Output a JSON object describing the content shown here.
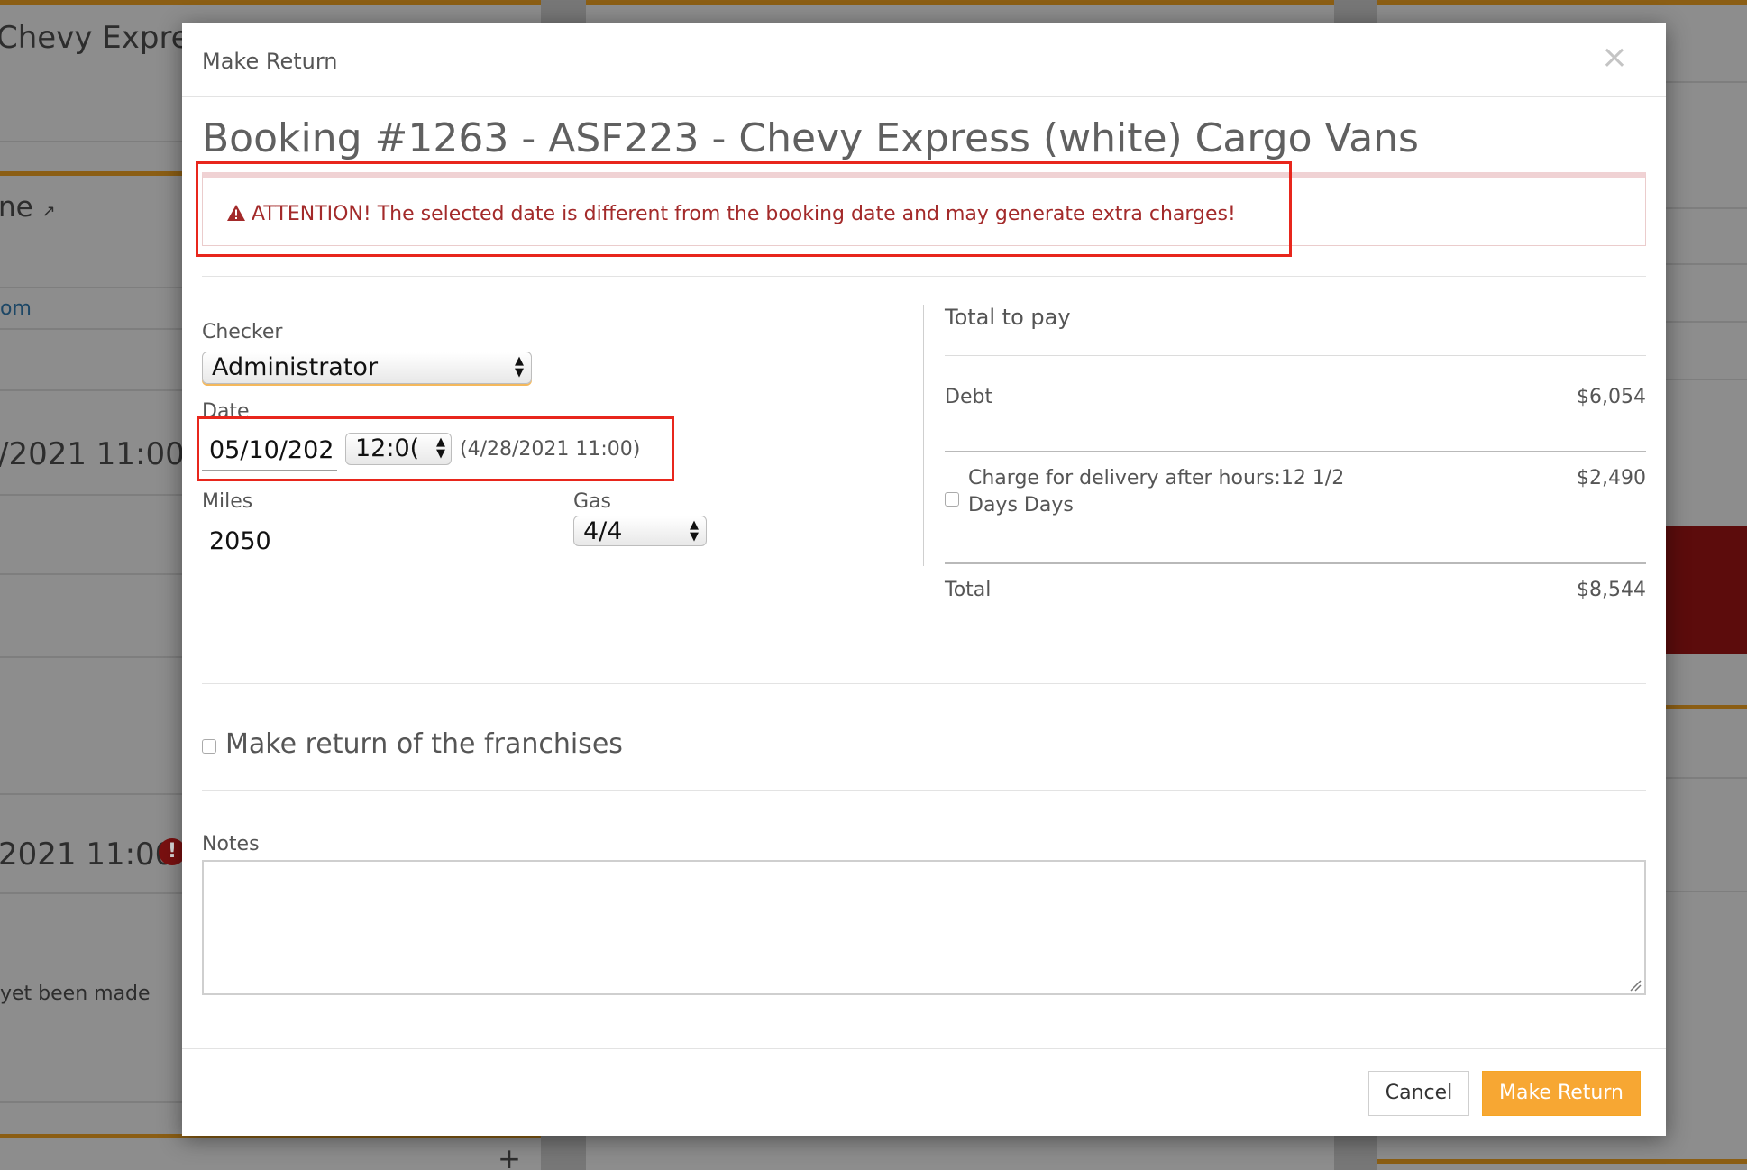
{
  "background": {
    "title_fragment": "Chevy Express",
    "name_fragment": "ne",
    "link_fragment": "om",
    "date_fragment_1": "/2021 11:00",
    "date_fragment_2": "2021 11:00",
    "status_fragment": "yet been made",
    "plus_symbol": "+"
  },
  "modal": {
    "title": "Make Return",
    "close_symbol": "×",
    "booking_title": "Booking #1263 - ASF223 - Chevy Express (white) Cargo Vans",
    "alert": "ATTENTION! The selected date is different from the booking date and may generate extra charges!",
    "form": {
      "checker_label": "Checker",
      "checker_value": "Administrator",
      "date_label": "Date",
      "date_value": "05/10/202",
      "time_value": "12:0(",
      "original_datetime": "(4/28/2021 11:00)",
      "miles_label": "Miles",
      "miles_value": "2050",
      "gas_label": "Gas",
      "gas_value": "4/4"
    },
    "summary": {
      "heading": "Total to pay",
      "debt_label": "Debt",
      "debt_value": "$6,054",
      "charge_label_line1": "Charge for delivery after hours:12 1/2",
      "charge_label_line2": "Days Days",
      "charge_value": "$2,490",
      "total_label": "Total",
      "total_value": "$8,544"
    },
    "franchise_label": "Make return of the franchises",
    "notes_label": "Notes",
    "notes_value": "",
    "buttons": {
      "cancel": "Cancel",
      "submit": "Make Return"
    }
  },
  "colors": {
    "accent": "#f7a733",
    "alert_text": "#a32a2a",
    "annotation_red": "#e8261c"
  }
}
